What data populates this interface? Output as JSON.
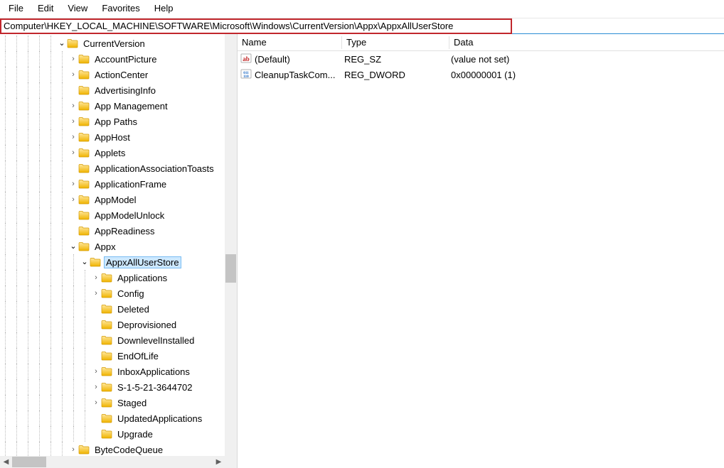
{
  "menu": [
    "File",
    "Edit",
    "View",
    "Favorites",
    "Help"
  ],
  "address": "Computer\\HKEY_LOCAL_MACHINE\\SOFTWARE\\Microsoft\\Windows\\CurrentVersion\\Appx\\AppxAllUserStore",
  "tree": [
    {
      "level": 5,
      "expand": "open",
      "label": "CurrentVersion",
      "selected": false
    },
    {
      "level": 6,
      "expand": "closed",
      "label": "AccountPicture"
    },
    {
      "level": 6,
      "expand": "closed",
      "label": "ActionCenter"
    },
    {
      "level": 6,
      "expand": "none",
      "label": "AdvertisingInfo"
    },
    {
      "level": 6,
      "expand": "closed",
      "label": "App Management"
    },
    {
      "level": 6,
      "expand": "closed",
      "label": "App Paths"
    },
    {
      "level": 6,
      "expand": "closed",
      "label": "AppHost"
    },
    {
      "level": 6,
      "expand": "closed",
      "label": "Applets"
    },
    {
      "level": 6,
      "expand": "none",
      "label": "ApplicationAssociationToasts"
    },
    {
      "level": 6,
      "expand": "closed",
      "label": "ApplicationFrame"
    },
    {
      "level": 6,
      "expand": "closed",
      "label": "AppModel"
    },
    {
      "level": 6,
      "expand": "none",
      "label": "AppModelUnlock"
    },
    {
      "level": 6,
      "expand": "none",
      "label": "AppReadiness"
    },
    {
      "level": 6,
      "expand": "open",
      "label": "Appx"
    },
    {
      "level": 7,
      "expand": "open",
      "label": "AppxAllUserStore",
      "selected": true
    },
    {
      "level": 8,
      "expand": "closed",
      "label": "Applications"
    },
    {
      "level": 8,
      "expand": "closed",
      "label": "Config"
    },
    {
      "level": 8,
      "expand": "none",
      "label": "Deleted"
    },
    {
      "level": 8,
      "expand": "none",
      "label": "Deprovisioned"
    },
    {
      "level": 8,
      "expand": "none",
      "label": "DownlevelInstalled"
    },
    {
      "level": 8,
      "expand": "none",
      "label": "EndOfLife"
    },
    {
      "level": 8,
      "expand": "closed",
      "label": "InboxApplications"
    },
    {
      "level": 8,
      "expand": "closed",
      "label": "S-1-5-21-3644702"
    },
    {
      "level": 8,
      "expand": "closed",
      "label": "Staged"
    },
    {
      "level": 8,
      "expand": "none",
      "label": "UpdatedApplications"
    },
    {
      "level": 8,
      "expand": "none",
      "label": "Upgrade"
    },
    {
      "level": 6,
      "expand": "closed",
      "label": "ByteCodeQueue"
    }
  ],
  "columns": {
    "name": "Name",
    "type": "Type",
    "data": "Data"
  },
  "values": [
    {
      "icon": "string",
      "name": "(Default)",
      "type": "REG_SZ",
      "data": "(value not set)"
    },
    {
      "icon": "binary",
      "name": "CleanupTaskCom...",
      "type": "REG_DWORD",
      "data": "0x00000001 (1)"
    }
  ]
}
